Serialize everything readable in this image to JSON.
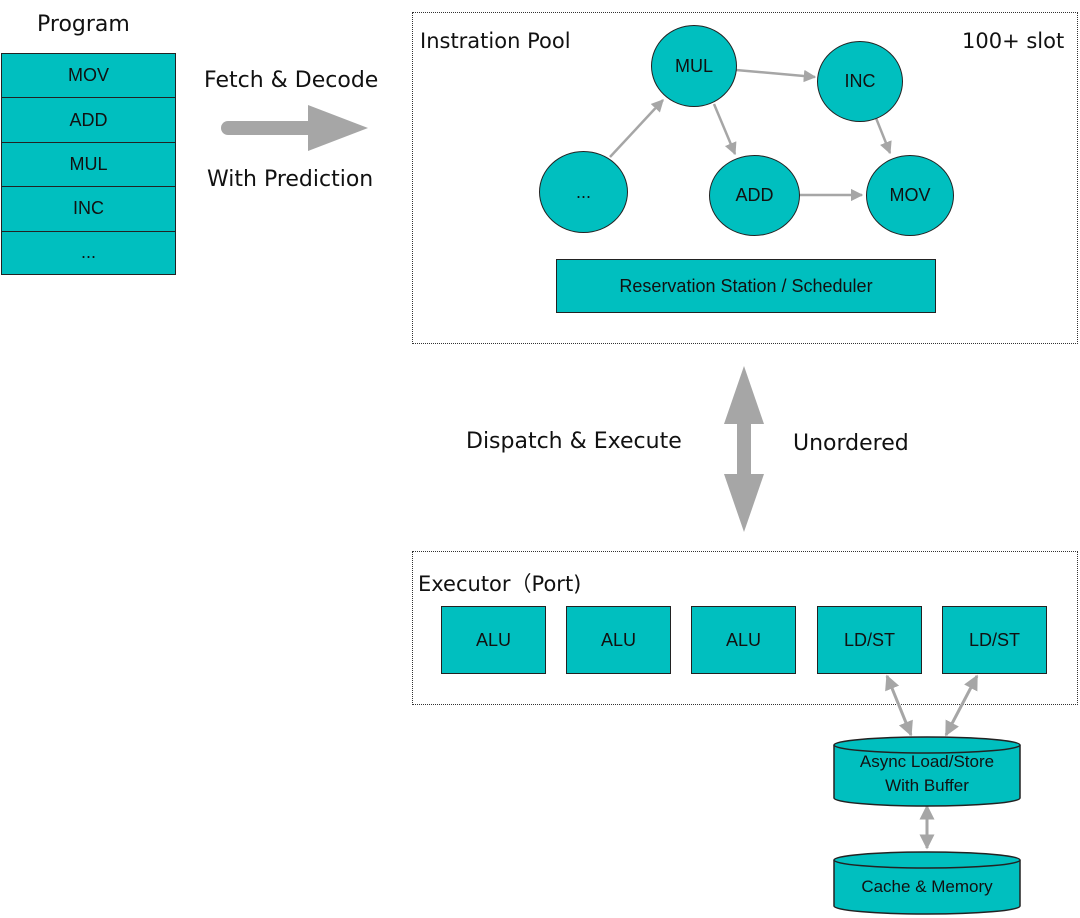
{
  "program": {
    "title": "Program",
    "instructions": [
      "MOV",
      "ADD",
      "MUL",
      "INC",
      "..."
    ]
  },
  "fetch": {
    "top_label": "Fetch & Decode",
    "bottom_label": "With Prediction"
  },
  "pool": {
    "title": "Instration Pool",
    "capacity": "100+ slot",
    "nodes": {
      "mul": "MUL",
      "inc": "INC",
      "ellipsis": "...",
      "add": "ADD",
      "mov": "MOV"
    },
    "scheduler": "Reservation Station / Scheduler"
  },
  "dispatch": {
    "left_label": "Dispatch & Execute",
    "right_label": "Unordered"
  },
  "executor": {
    "title": "Executor（Port)",
    "ports": [
      "ALU",
      "ALU",
      "ALU",
      "LD/ST",
      "LD/ST"
    ]
  },
  "storage": {
    "buffer_line1": "Async Load/Store",
    "buffer_line2": "With Buffer",
    "memory": "Cache & Memory"
  },
  "colors": {
    "teal": "#00bfbf",
    "arrow_gray": "#a6a6a6",
    "outline": "#222222"
  }
}
